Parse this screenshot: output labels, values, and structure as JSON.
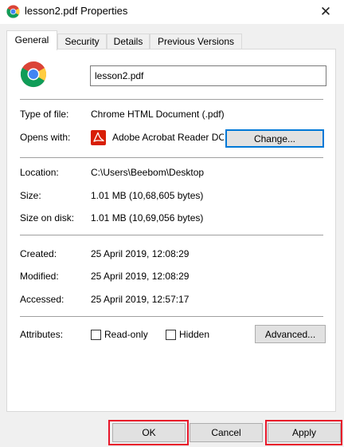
{
  "window": {
    "title": "lesson2.pdf Properties",
    "close_glyph": "✕",
    "icon": "chrome-icon"
  },
  "tabs": [
    {
      "label": "General",
      "active": true
    },
    {
      "label": "Security",
      "active": false
    },
    {
      "label": "Details",
      "active": false
    },
    {
      "label": "Previous Versions",
      "active": false
    }
  ],
  "general": {
    "file_name": "lesson2.pdf",
    "type_label": "Type of file:",
    "type_value": "Chrome HTML Document (.pdf)",
    "opens_label": "Opens with:",
    "opens_value": "Adobe Acrobat Reader DC",
    "change_label": "Change...",
    "location_label": "Location:",
    "location_value": "C:\\Users\\Beebom\\Desktop",
    "size_label": "Size:",
    "size_value": "1.01 MB (10,68,605 bytes)",
    "size_disk_label": "Size on disk:",
    "size_disk_value": "1.01 MB (10,69,056 bytes)",
    "created_label": "Created:",
    "created_value": "25 April 2019, 12:08:29",
    "modified_label": "Modified:",
    "modified_value": "25 April 2019, 12:08:29",
    "accessed_label": "Accessed:",
    "accessed_value": "25 April 2019, 12:57:17",
    "attributes_label": "Attributes:",
    "readonly_label": "Read-only",
    "hidden_label": "Hidden",
    "advanced_label": "Advanced..."
  },
  "footer": {
    "ok_label": "OK",
    "cancel_label": "Cancel",
    "apply_label": "Apply"
  },
  "colors": {
    "highlight_box": "#e8162a",
    "focus_border": "#0078d7",
    "pdf_red": "#d81e06"
  }
}
